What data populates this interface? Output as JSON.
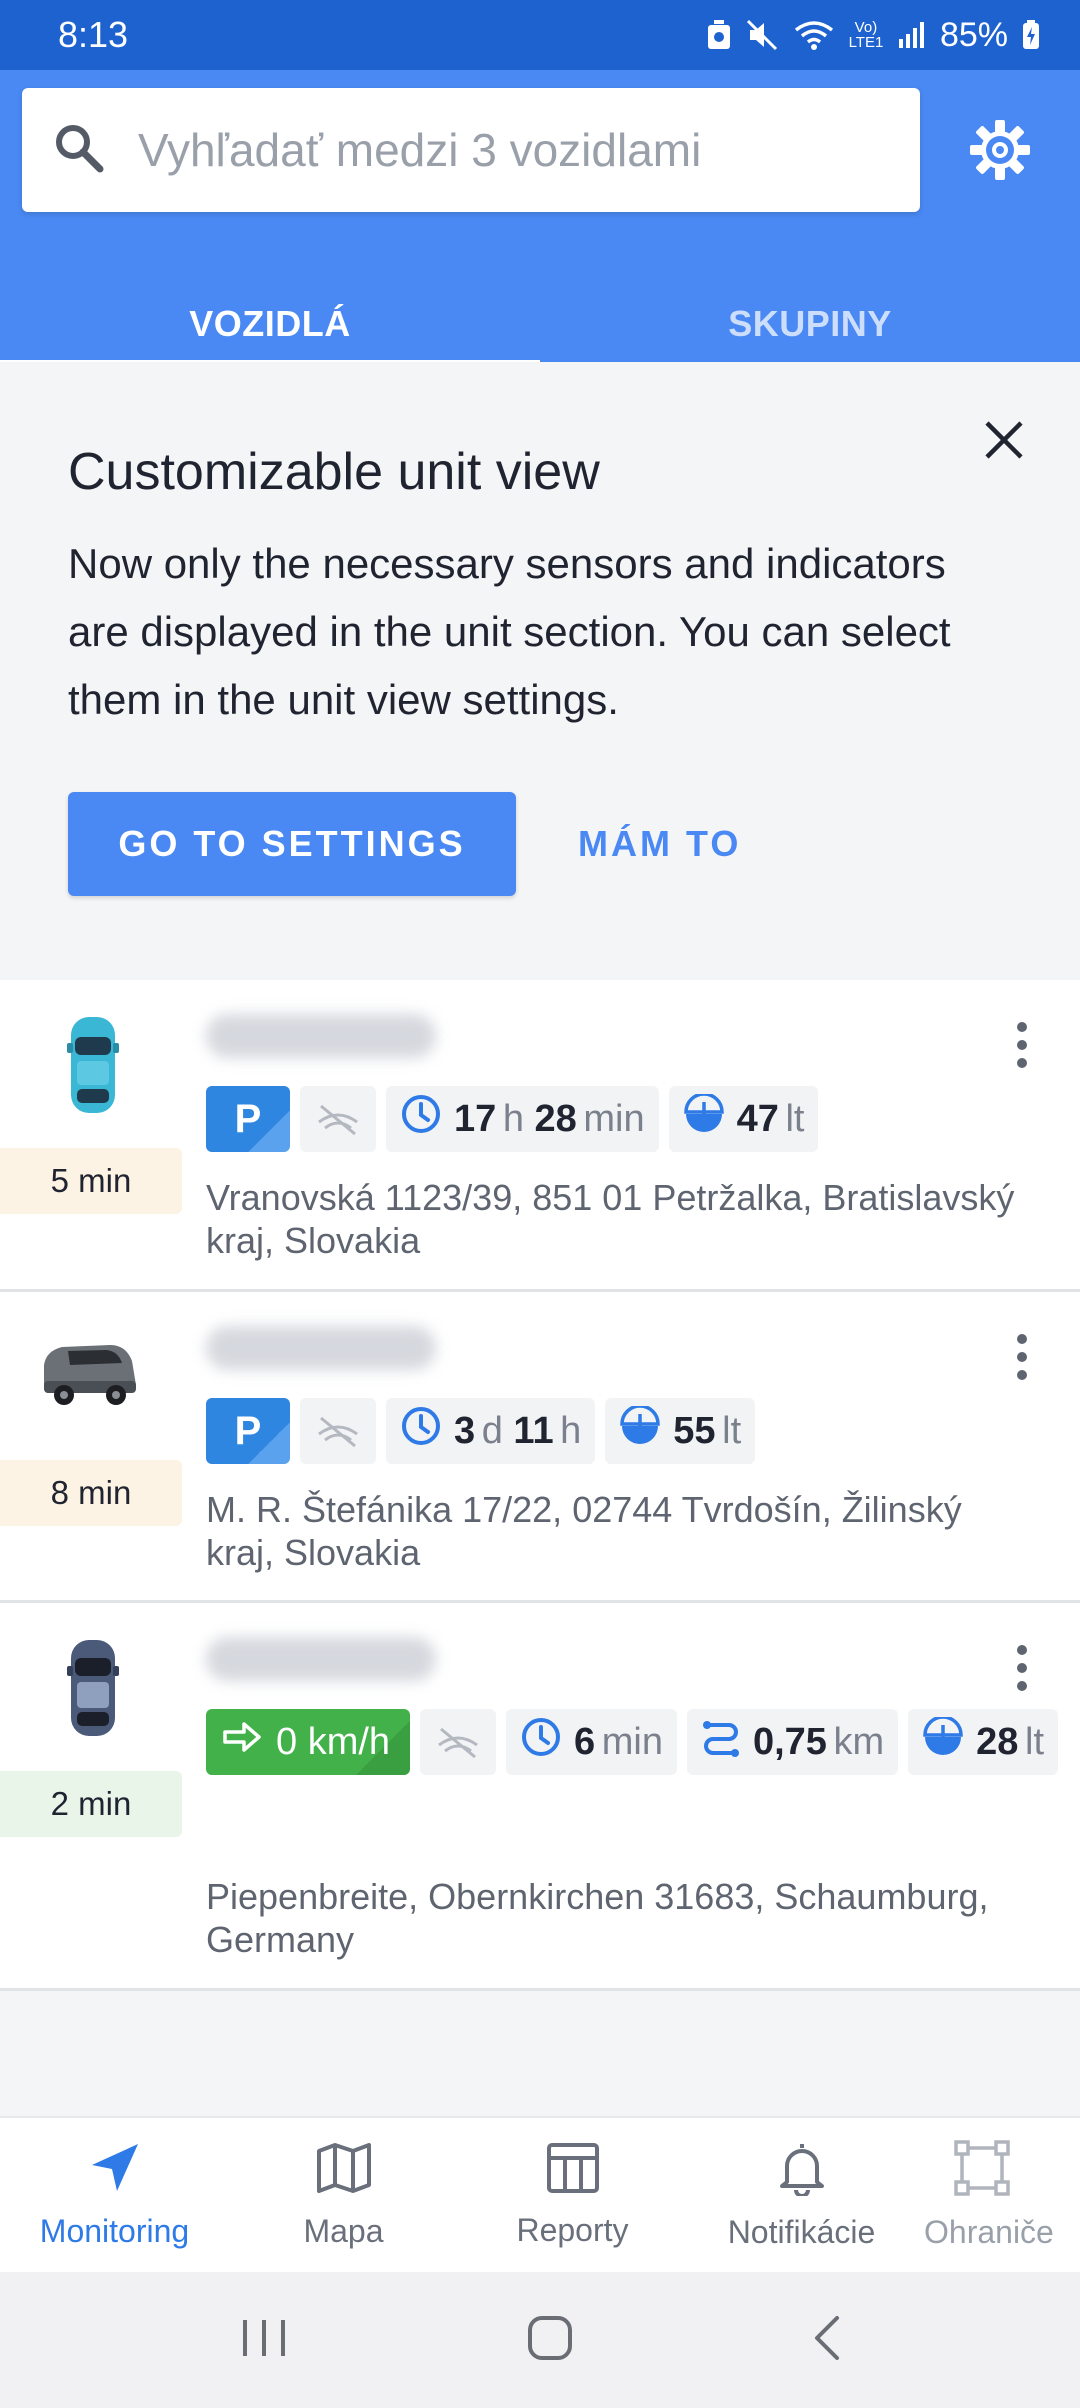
{
  "status_bar": {
    "time": "8:13",
    "battery": "85%",
    "network_label": "Vo) LTE1"
  },
  "search": {
    "placeholder": "Vyhľadať medzi 3 vozidlami"
  },
  "tabs": [
    {
      "label": "VOZIDLÁ",
      "active": true
    },
    {
      "label": "SKUPINY",
      "active": false
    }
  ],
  "banner": {
    "title": "Customizable unit view",
    "text": "Now only the necessary sensors and indicators are displayed in the unit section. You can select them in the unit view settings.",
    "primary_button": "GO TO SETTINGS",
    "secondary_button": "MÁM TO"
  },
  "units": [
    {
      "icon": "car-top-icon",
      "age": "5 min",
      "age_color": "#fdf3e4",
      "state": "P",
      "duration": {
        "a_num": "17",
        "a_unit": "h",
        "b_num": "28",
        "b_unit": "min"
      },
      "fuel": {
        "num": "47",
        "unit": "lt"
      },
      "address": "Vranovská 1123/39, 851 01 Petržalka, Bratislavský kraj, Slovakia"
    },
    {
      "icon": "van-icon",
      "age": "8 min",
      "age_color": "#fdf3e4",
      "state": "P",
      "duration": {
        "a_num": "3",
        "a_unit": "d",
        "b_num": "11",
        "b_unit": "h"
      },
      "fuel": {
        "num": "55",
        "unit": "lt"
      },
      "address": "M. R. Štefánika 17/22, 02744 Tvrdošín, Žilinský kraj, Slovakia"
    },
    {
      "icon": "car-top-dark-icon",
      "age": "2 min",
      "age_color": "#eaf5ea",
      "speed": "0 km/h",
      "duration": {
        "num": "6",
        "unit": "min"
      },
      "mileage": {
        "num": "0,75",
        "unit": "km"
      },
      "fuel": {
        "num": "28",
        "unit": "lt"
      },
      "address": "Piepenbreite, Obernkirchen 31683, Schaumburg, Germany"
    }
  ],
  "bottom_nav": [
    {
      "label": "Monitoring",
      "icon": "navigation-arrow-icon",
      "active": true
    },
    {
      "label": "Mapa",
      "icon": "map-icon",
      "active": false
    },
    {
      "label": "Reporty",
      "icon": "report-icon",
      "active": false
    },
    {
      "label": "Notifikácie",
      "icon": "bell-icon",
      "active": false
    },
    {
      "label": "Ohraniče",
      "icon": "geofence-icon",
      "active": false
    }
  ],
  "colors": {
    "accent": "#4a89f3",
    "status_bar": "#1e62d0",
    "moving": "#43b14a",
    "parking": "#2f86e0"
  }
}
